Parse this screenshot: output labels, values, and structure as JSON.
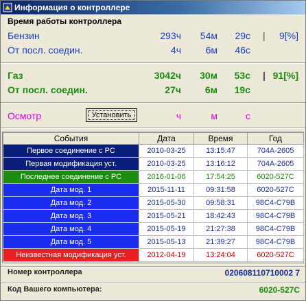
{
  "window": {
    "title": "Информация о контроллере"
  },
  "runtime": {
    "header": "Время работы контроллера",
    "rows": [
      {
        "label": "Бензин",
        "h": "293ч",
        "m": "54м",
        "s": "29с",
        "sep": "|",
        "pct": "9[%]",
        "color": "blue"
      },
      {
        "label": "От посл. соедин.",
        "h": "4ч",
        "m": "6м",
        "s": "46с",
        "sep": "",
        "pct": "",
        "color": "blue"
      },
      {
        "label": "Газ",
        "h": "3042ч",
        "m": "30м",
        "s": "53с",
        "sep": "|",
        "pct": "91[%]",
        "color": "green"
      },
      {
        "label": "От посл. соедин.",
        "h": "27ч",
        "m": "6м",
        "s": "19с",
        "sep": "",
        "pct": "",
        "color": "green"
      }
    ],
    "inspection": {
      "label": "Осмотр",
      "button": "Установить",
      "h": "ч",
      "m": "м",
      "s": "с"
    }
  },
  "events_table": {
    "headers": [
      "События",
      "Дата",
      "Время",
      "Год"
    ],
    "rows": [
      {
        "event": "Первое соединение с PC",
        "date": "2010-03-25",
        "time": "13:15:47",
        "code": "704A-2605",
        "bg": "#0a1f7a"
      },
      {
        "event": "Первая модификация уст.",
        "date": "2010-03-25",
        "time": "13:16:12",
        "code": "704A-2605",
        "bg": "#0a1f7a"
      },
      {
        "event": "Последнее соединение с PC",
        "date": "2016-01-06",
        "time": "17:54:25",
        "code": "6020-527C",
        "bg": "#1c8c10",
        "highlight": "green"
      },
      {
        "event": "Дата мод. 1",
        "date": "2015-11-11",
        "time": "09:31:58",
        "code": "6020-527C",
        "bg": "#1a2cf0"
      },
      {
        "event": "Дата мод. 2",
        "date": "2015-05-30",
        "time": "09:58:31",
        "code": "98C4-C79B",
        "bg": "#1a2cf0"
      },
      {
        "event": "Дата мод. 3",
        "date": "2015-05-21",
        "time": "18:42:43",
        "code": "98C4-C79B",
        "bg": "#1a2cf0"
      },
      {
        "event": "Дата мод. 4",
        "date": "2015-05-19",
        "time": "21:27:38",
        "code": "98C4-C79B",
        "bg": "#1a2cf0"
      },
      {
        "event": "Дата мод. 5",
        "date": "2015-05-13",
        "time": "21:39:27",
        "code": "98C4-C79B",
        "bg": "#1a2cf0"
      },
      {
        "event": "Неизвестная модификация уст.",
        "date": "2012-04-19",
        "time": "13:24:04",
        "code": "6020-527C",
        "bg": "#e82020",
        "highlight": "red"
      }
    ]
  },
  "footer": {
    "controller_label": "Номер контроллера",
    "controller_value": "020608110710002 7",
    "pc_label": "Код Вашего компьютера:",
    "pc_value": "6020-527C"
  },
  "colors": {
    "blue_text": "#1a3ec2",
    "green_text": "#1a8a10",
    "magenta_text": "#e000e0",
    "title_start": "#0a246a"
  },
  "icons": {
    "title": "controller-app-icon"
  }
}
